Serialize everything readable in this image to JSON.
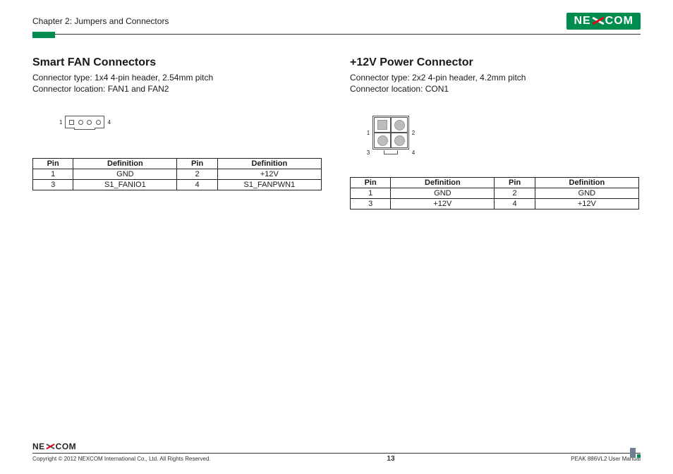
{
  "header": {
    "chapter": "Chapter 2: Jumpers and Connectors",
    "logo_ne": "NE",
    "logo_com": "COM"
  },
  "left": {
    "title": "Smart FAN Connectors",
    "type_line": "Connector type: 1x4 4-pin header, 2.54mm pitch",
    "loc_line": "Connector location: FAN1 and FAN2",
    "diagram": {
      "pin_left": "1",
      "pin_right": "4"
    },
    "table": {
      "headers": {
        "pin": "Pin",
        "def": "Definition"
      },
      "rows": [
        {
          "p1": "1",
          "d1": "GND",
          "p2": "2",
          "d2": "+12V"
        },
        {
          "p1": "3",
          "d1": "S1_FANIO1",
          "p2": "4",
          "d2": "S1_FANPWN1"
        }
      ]
    }
  },
  "right": {
    "title": "+12V Power Connector",
    "type_line": "Connector type: 2x2 4-pin header, 4.2mm pitch",
    "loc_line": "Connector location: CON1",
    "diagram": {
      "p1": "1",
      "p2": "2",
      "p3": "3",
      "p4": "4"
    },
    "table": {
      "headers": {
        "pin": "Pin",
        "def": "Definition"
      },
      "rows": [
        {
          "p1": "1",
          "d1": "GND",
          "p2": "2",
          "d2": "GND"
        },
        {
          "p1": "3",
          "d1": "+12V",
          "p2": "4",
          "d2": "+12V"
        }
      ]
    }
  },
  "footer": {
    "logo_ne": "NE",
    "logo_com": "COM",
    "copyright": "Copyright © 2012 NEXCOM International Co., Ltd. All Rights Reserved.",
    "page": "13",
    "manual": "PEAK 886VL2 User Manual"
  }
}
